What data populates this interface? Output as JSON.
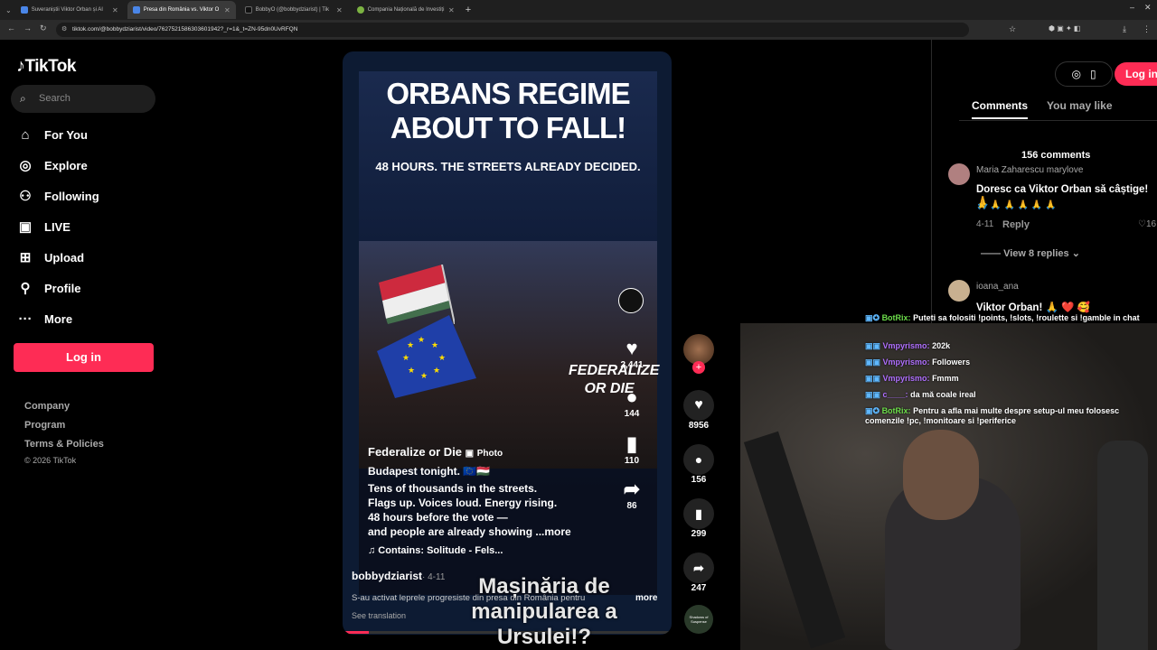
{
  "browser": {
    "tabs": [
      {
        "title": "Suveraniștii Viktor Orban și AI",
        "active": false,
        "color": "#4a86e8"
      },
      {
        "title": "Presa din România vs. Viktor O",
        "active": true,
        "color": "#4a86e8"
      },
      {
        "title": "BobbyO (@bobbydziarist) | Tik",
        "active": false,
        "color": "#111111"
      },
      {
        "title": "Compania Națională de Investiți",
        "active": false,
        "color": "#7cb342"
      }
    ],
    "new_tab": "+",
    "url": "tiktok.com/@bobbydziarist/video/7627521586303601942?_r=1&_t=ZN-95dn0UvRFQN"
  },
  "sidebar": {
    "logo": "TikTok",
    "search_placeholder": "Search",
    "nav": [
      {
        "label": "For You",
        "icon": "home-icon",
        "glyph": "⌂"
      },
      {
        "label": "Explore",
        "icon": "compass-icon",
        "glyph": "◎"
      },
      {
        "label": "Following",
        "icon": "following-icon",
        "glyph": "⚇"
      },
      {
        "label": "LIVE",
        "icon": "live-icon",
        "glyph": "▣"
      },
      {
        "label": "Upload",
        "icon": "upload-icon",
        "glyph": "⊞"
      },
      {
        "label": "Profile",
        "icon": "profile-icon",
        "glyph": "⚲"
      },
      {
        "label": "More",
        "icon": "more-icon",
        "glyph": "···"
      }
    ],
    "login": "Log in",
    "footer": [
      "Company",
      "Program",
      "Terms & Policies"
    ],
    "copyright": "© 2026 TikTok"
  },
  "video": {
    "headline": "ORBANS REGIME ABOUT TO FALL!",
    "subhead": "48 HOURS. THE STREETS ALREADY DECIDED.",
    "watermark": "FEDERALIZE OR DIE",
    "poster_account": "Federalize or Die",
    "poster_tag": "Photo",
    "caption_line1": "Budapest tonight.",
    "caption_lines": [
      "Tens of thousands in the streets.",
      "Flags up. Voices loud. Energy rising.",
      "48 hours before the vote —",
      "and people are already showing ...more"
    ],
    "sound": "♫ Contains: Solitude - Fels...",
    "inner_like": "2,441",
    "inner_comment": "144",
    "inner_save": "110",
    "inner_share": "86",
    "author": "bobbydziarist",
    "date": "· 4-11",
    "description": "S-au activat leprele progresiste din presa din România pentru",
    "more": "more",
    "see_translation": "See translation",
    "overlay": "Mașinăria de manipularea a Ursulei!?",
    "likes": "8956",
    "comments": "156",
    "saves": "299",
    "shares": "247",
    "music_label": "Shadows of Suspense"
  },
  "right": {
    "login": "Log in",
    "tab_comments": "Comments",
    "tab_like": "You may like",
    "count": "156 comments",
    "c1_user": "Maria Zaharescu marylove",
    "c1_text": "Doresc ca Viktor Orban să câștige! 🙏",
    "c1_emoji": "🙏 🙏 🙏 🙏 🙏 🙏",
    "c1_date": "4-11",
    "c1_reply": "Reply",
    "c1_likes": "16",
    "c1_replies": "View 8 replies",
    "c2_user": "ioana_ana",
    "c2_text": "Viktor Orban! 🙏 ❤️ 🥰"
  },
  "stream_chat": [
    {
      "user": "BotRix:",
      "text": "Puteti sa folositi !points, !slots, !roulette si !gamble in chat",
      "color": "#6dde4b"
    },
    {
      "user": "Vmpyrismo:",
      "text": "202k",
      "color": "#b070ff"
    },
    {
      "user": "Vmpyrismo:",
      "text": "Followers",
      "color": "#b070ff"
    },
    {
      "user": "Vmpyrismo:",
      "text": "Fmmm",
      "color": "#b070ff"
    },
    {
      "user": "c____:",
      "text": "da mă coale ireal",
      "color": "#b070ff"
    },
    {
      "user": "BotRix:",
      "text": "Pentru a afla mai multe despre setup-ul meu folosesc comenzile !pc, !monitoare si !periferice",
      "color": "#6dde4b"
    }
  ]
}
